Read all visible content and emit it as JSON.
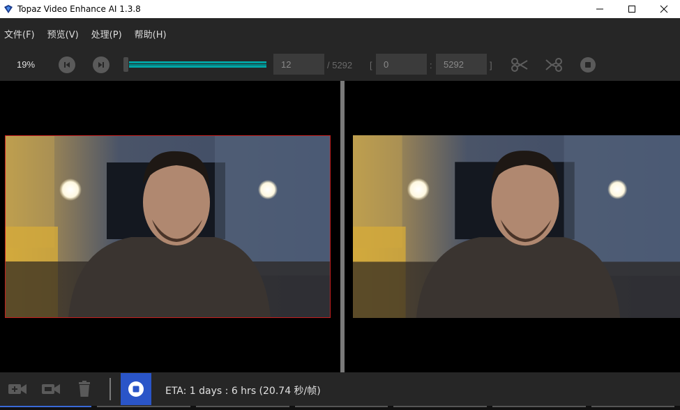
{
  "window": {
    "title": "Topaz Video Enhance AI 1.3.8",
    "controls": [
      "minimize-icon",
      "maximize-icon",
      "close-icon"
    ]
  },
  "menu": {
    "items": [
      {
        "label": "文件(F)",
        "key": "F"
      },
      {
        "label": "预览(V)",
        "key": "V"
      },
      {
        "label": "处理(P)",
        "key": "P"
      },
      {
        "label": "帮助(H)",
        "key": "H"
      }
    ]
  },
  "toolbar": {
    "zoom": "19%",
    "prev_icon": "skip-previous-icon",
    "next_icon": "skip-next-icon",
    "current_frame": "12",
    "total_frames": "/ 5292",
    "range_open": "[",
    "range_start": "0",
    "range_sep": ":",
    "range_end": "5292",
    "range_close": "]",
    "cut_icon": "scissors-icon",
    "join_icon": "join-icon",
    "stop_icon": "stop-icon",
    "slider_progress": 0.99,
    "accent": "#008b8b"
  },
  "preview": {
    "left_border_color": "#c41e1e",
    "divider_color": "#7a7a7a"
  },
  "bottom": {
    "icons": [
      "add-camera-icon",
      "camera-icon",
      "trash-icon"
    ],
    "stop_icon": "stop-icon",
    "stop_bg": "#2a55c8",
    "eta": "ETA:  1 days : 6 hrs  (20.74 秒/帧)"
  }
}
